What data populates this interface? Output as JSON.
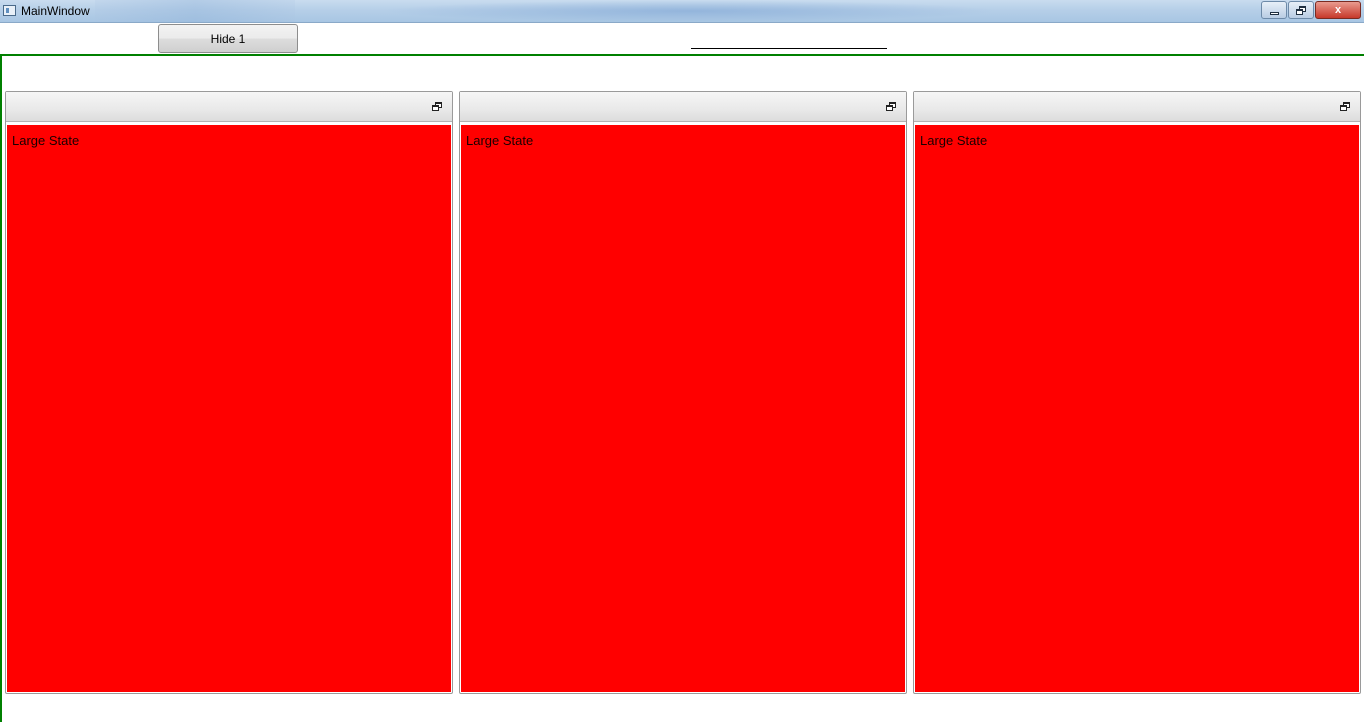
{
  "window": {
    "title": "MainWindow",
    "caption_close": "x"
  },
  "toolbar": {
    "hide_button_label": "Hide 1"
  },
  "panels": [
    {
      "label": "Large State"
    },
    {
      "label": "Large State"
    },
    {
      "label": "Large State"
    }
  ],
  "colors": {
    "frame_border": "#008000",
    "panel_fill": "#ff0000"
  }
}
